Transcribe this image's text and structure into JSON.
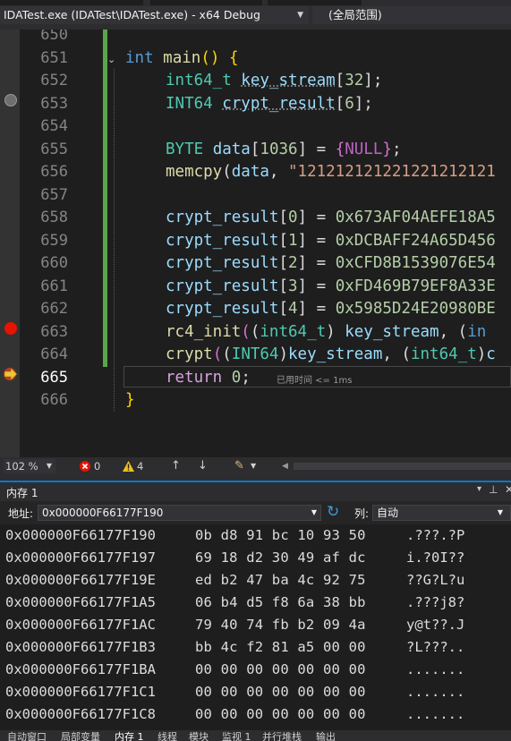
{
  "nav": {
    "file_combo": "IDATest.exe (IDATest\\IDATest.exe) - x64 Debug",
    "scope_combo": "(全局范围)"
  },
  "editor": {
    "line_numbers": [
      "650",
      "651",
      "652",
      "653",
      "654",
      "655",
      "656",
      "657",
      "658",
      "659",
      "660",
      "661",
      "662",
      "663",
      "664",
      "665",
      "666"
    ],
    "current_line": "665",
    "elapsed_hint": "已用时间 <= 1ms"
  },
  "status": {
    "zoom": "102 %",
    "errors": "0",
    "warnings": "4"
  },
  "memory_panel": {
    "title": "内存 1",
    "address_label": "地址:",
    "address_value": "0x000000F66177F190",
    "columns_label": "列:",
    "columns_value": "自动",
    "rows": [
      {
        "addr": "0x000000F66177F190",
        "hex": "0b d8 91 bc 10 93 50",
        "text": ".???.?P"
      },
      {
        "addr": "0x000000F66177F197",
        "hex": "69 18 d2 30 49 af dc",
        "text": "i.?0I??"
      },
      {
        "addr": "0x000000F66177F19E",
        "hex": "ed b2 47 ba 4c 92 75",
        "text": "??G?L?u"
      },
      {
        "addr": "0x000000F66177F1A5",
        "hex": "06 b4 d5 f8 6a 38 bb",
        "text": ".???j8?"
      },
      {
        "addr": "0x000000F66177F1AC",
        "hex": "79 40 74 fb b2 09 4a",
        "text": "y@t??.J"
      },
      {
        "addr": "0x000000F66177F1B3",
        "hex": "bb 4c f2 81 a5 00 00",
        "text": "?L???.."
      },
      {
        "addr": "0x000000F66177F1BA",
        "hex": "00 00 00 00 00 00 00",
        "text": "......."
      },
      {
        "addr": "0x000000F66177F1C1",
        "hex": "00 00 00 00 00 00 00",
        "text": "......."
      },
      {
        "addr": "0x000000F66177F1C8",
        "hex": "00 00 00 00 00 00 00",
        "text": "......."
      }
    ]
  },
  "bottom_tabs": [
    "自动窗口",
    "局部变量",
    "内存 1",
    "线程",
    "模块",
    "监视 1",
    "并行堆栈",
    "输出"
  ],
  "colors": {
    "keyword": "#569cd6",
    "type": "#4ec9b0",
    "function": "#dcdcaa",
    "variable": "#9cdcfe",
    "number": "#b5cea8",
    "string": "#d69d85",
    "macro": "#bd63c5",
    "accent": "#007acc",
    "breakpoint": "#e51400"
  },
  "icons": [
    "breakpoint-disabled-icon",
    "breakpoint-icon",
    "current-statement-arrow-icon",
    "error-icon",
    "warning-icon",
    "refresh-icon",
    "pin-icon",
    "close-icon"
  ]
}
